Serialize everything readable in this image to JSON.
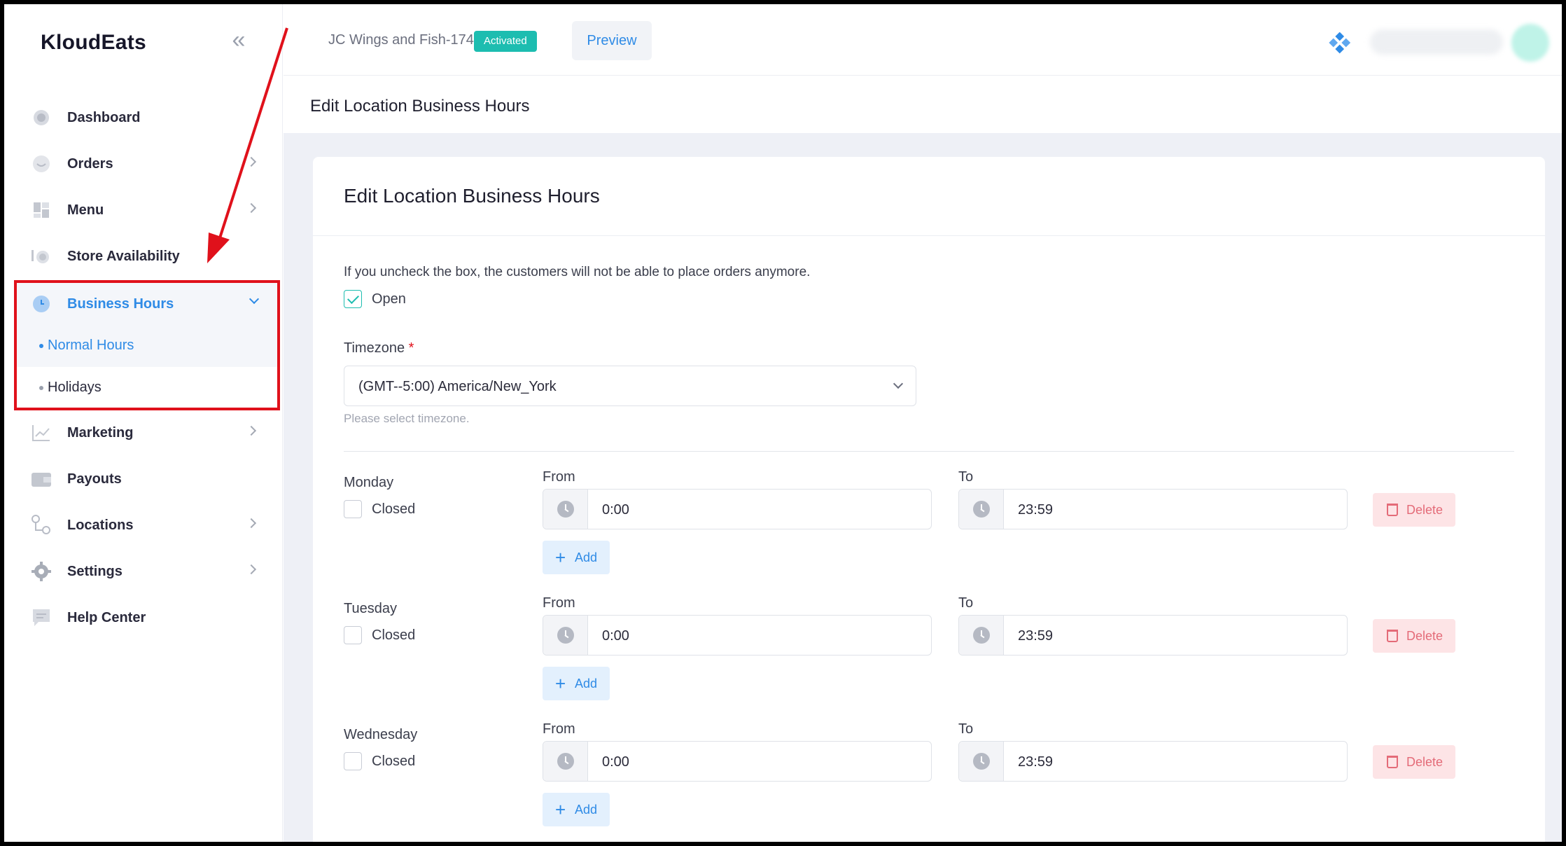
{
  "app": {
    "brand": "KloudEats"
  },
  "sidebar": {
    "items": [
      {
        "label": "Dashboard",
        "icon": "dashboard-icon"
      },
      {
        "label": "Orders",
        "icon": "orders-icon"
      },
      {
        "label": "Menu",
        "icon": "menu-icon"
      },
      {
        "label": "Store Availability",
        "icon": "store-availability-icon"
      },
      {
        "label": "Business Hours",
        "icon": "clock-icon"
      },
      {
        "label": "Marketing",
        "icon": "chart-line-icon"
      },
      {
        "label": "Payouts",
        "icon": "wallet-icon"
      },
      {
        "label": "Locations",
        "icon": "locations-icon"
      },
      {
        "label": "Settings",
        "icon": "gear-icon"
      },
      {
        "label": "Help Center",
        "icon": "chat-icon"
      }
    ],
    "business_hours_sub": [
      {
        "label": "Normal Hours"
      },
      {
        "label": "Holidays"
      }
    ]
  },
  "topbar": {
    "location_name": "JC Wings and Fish-174",
    "status_badge": "Activated",
    "preview_label": "Preview"
  },
  "subheader": {
    "title": "Edit Location Business Hours"
  },
  "card": {
    "title": "Edit Location Business Hours",
    "hint": "If you uncheck the box, the customers will not be able to place orders anymore.",
    "open_label": "Open",
    "open_checked": true,
    "timezone_label": "Timezone",
    "timezone_required": "*",
    "timezone_value": "(GMT--5:00) America/New_York",
    "timezone_help": "Please select timezone."
  },
  "days": [
    {
      "name": "Monday",
      "closed_label": "Closed",
      "from_label": "From",
      "to_label": "To",
      "from": "0:00",
      "to": "23:59",
      "add_label": "Add",
      "delete_label": "Delete"
    },
    {
      "name": "Tuesday",
      "closed_label": "Closed",
      "from_label": "From",
      "to_label": "To",
      "from": "0:00",
      "to": "23:59",
      "add_label": "Add",
      "delete_label": "Delete"
    },
    {
      "name": "Wednesday",
      "closed_label": "Closed",
      "from_label": "From",
      "to_label": "To",
      "from": "0:00",
      "to": "23:59",
      "add_label": "Add",
      "delete_label": "Delete"
    }
  ],
  "colors": {
    "accent": "#2f8be6",
    "badge": "#1dbdb0",
    "highlight_box": "#e0111b",
    "delete": "#e46b78"
  }
}
